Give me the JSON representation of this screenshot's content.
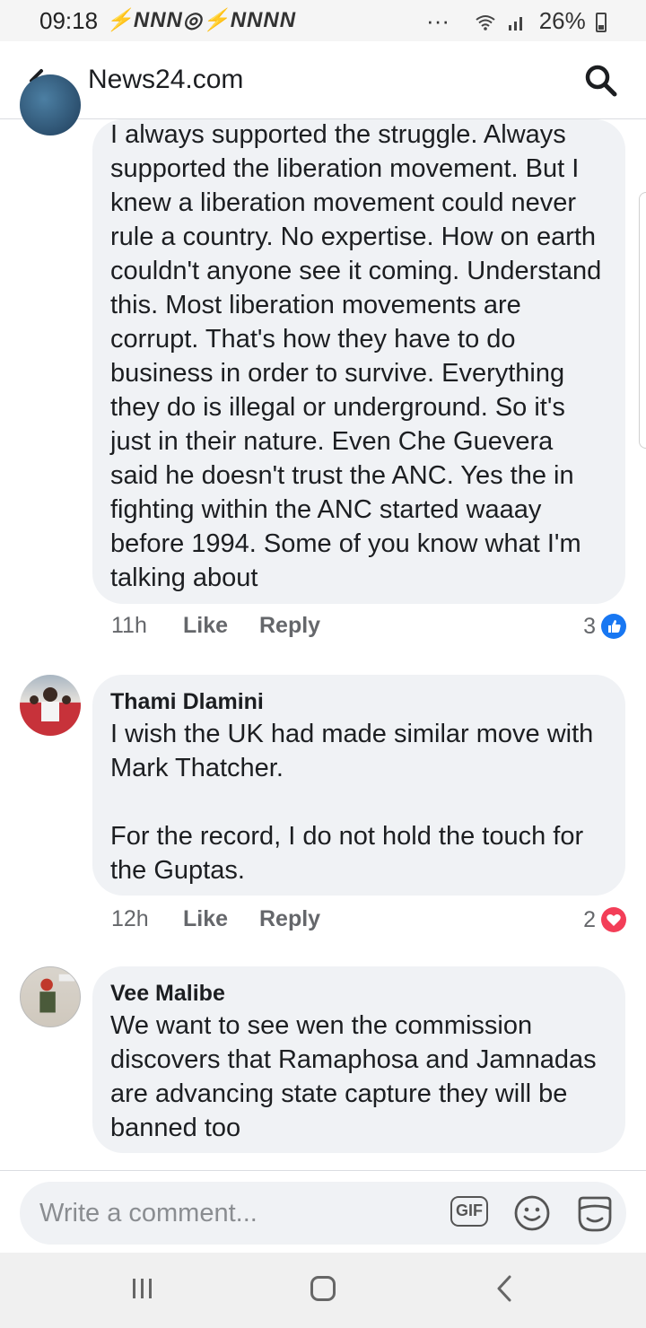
{
  "status_bar": {
    "time": "09:18",
    "notification_icons": "⚡NNN◎⚡NNNN",
    "more": "···",
    "battery_percent": "26%"
  },
  "header": {
    "title": "News24.com"
  },
  "comments": [
    {
      "author": "",
      "text": "I always supported the struggle. Always supported the liberation movement. But I knew a liberation movement could never rule a country. No expertise. How on earth couldn't anyone see it coming. Understand this. Most liberation movements are corrupt. That's how they have to do business in order to survive. Everything they do is illegal or underground. So it's just in their nature. Even Che Guevera said he doesn't trust the ANC. Yes the in fighting within the ANC started waaay before 1994. Some of you know what I'm talking about",
      "time": "11h",
      "like_label": "Like",
      "reply_label": "Reply",
      "reaction_count": "3",
      "reaction_type": "like",
      "avatar_icon": "avatar-icon"
    },
    {
      "author": "Thami Dlamini",
      "text": "I wish the UK had made similar move with Mark Thatcher.\n\nFor the record,  I do not hold the touch for the Guptas.",
      "time": "12h",
      "like_label": "Like",
      "reply_label": "Reply",
      "reaction_count": "2",
      "reaction_type": "love",
      "avatar_icon": "avatar-icon"
    },
    {
      "author": "Vee Malibe",
      "text": "We want to see wen the commission discovers that Ramaphosa and Jamnadas are advancing state capture they will be banned too",
      "time": "",
      "like_label": "",
      "reply_label": "",
      "reaction_count": "",
      "reaction_type": "like",
      "avatar_icon": "avatar-icon"
    }
  ],
  "composer": {
    "placeholder": "Write a comment...",
    "gif_label": "GIF"
  },
  "colors": {
    "like_blue": "#1877f2",
    "love_red": "#f33e58",
    "bubble_bg": "#f0f2f5"
  }
}
